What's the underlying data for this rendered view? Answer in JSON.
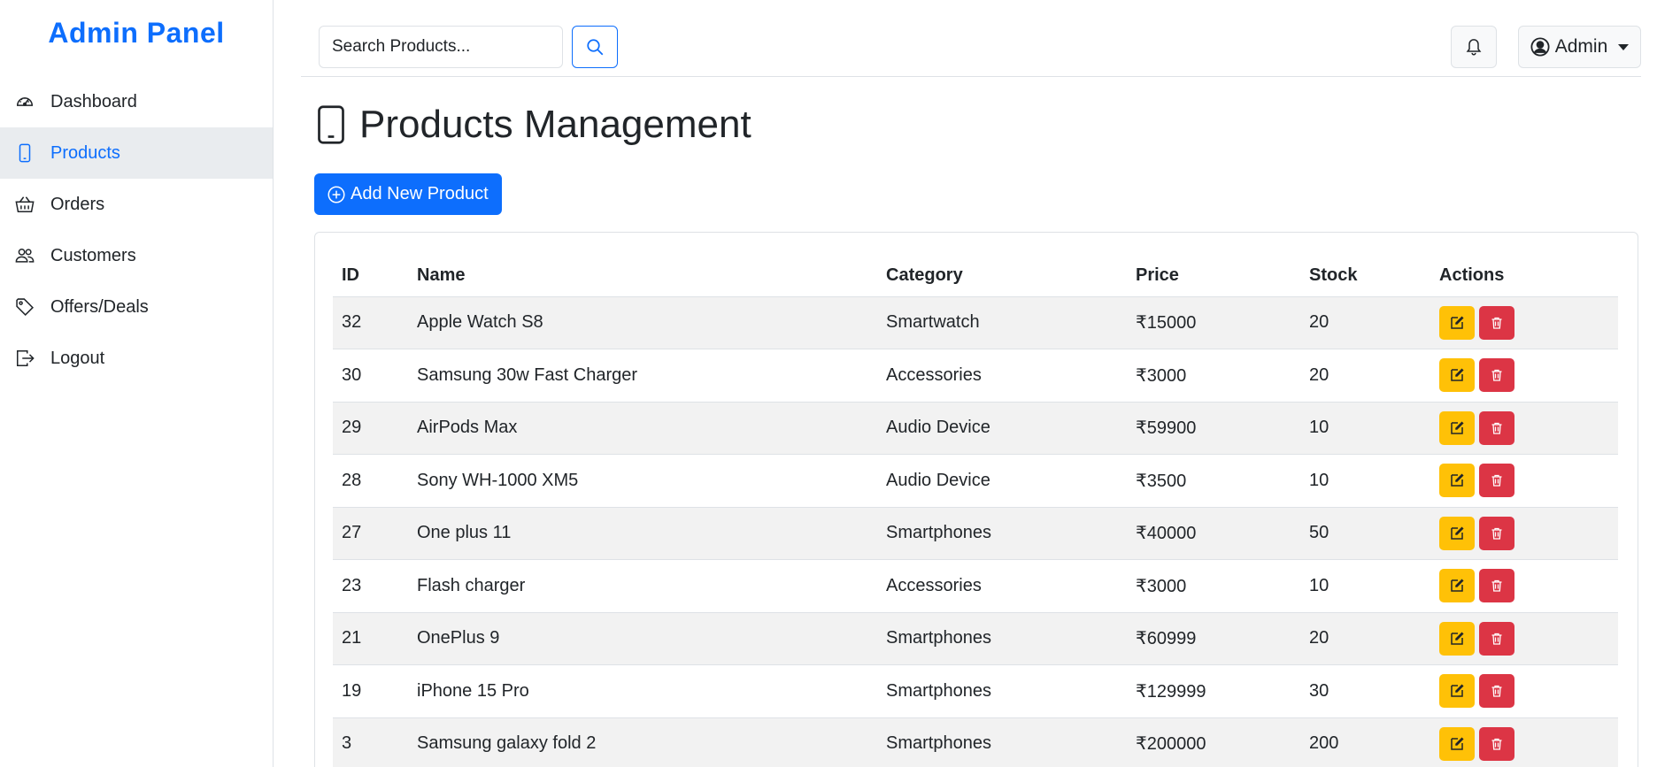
{
  "sidebar": {
    "brand": "Admin Panel",
    "items": [
      {
        "label": "Dashboard",
        "icon": "speedometer-icon"
      },
      {
        "label": "Products",
        "icon": "phone-icon",
        "active": true
      },
      {
        "label": "Orders",
        "icon": "basket-icon"
      },
      {
        "label": "Customers",
        "icon": "people-icon"
      },
      {
        "label": "Offers/Deals",
        "icon": "tag-icon"
      },
      {
        "label": "Logout",
        "icon": "logout-icon"
      }
    ]
  },
  "topbar": {
    "search_placeholder": "Search Products...",
    "user_label": "Admin"
  },
  "main": {
    "title": "Products Management",
    "add_button_label": "Add New Product"
  },
  "table": {
    "headers": [
      "ID",
      "Name",
      "Category",
      "Price",
      "Stock",
      "Actions"
    ],
    "rows": [
      {
        "id": "32",
        "name": "Apple Watch S8",
        "category": "Smartwatch",
        "price": "₹15000",
        "stock": "20"
      },
      {
        "id": "30",
        "name": "Samsung 30w Fast Charger",
        "category": "Accessories",
        "price": "₹3000",
        "stock": "20"
      },
      {
        "id": "29",
        "name": "AirPods Max",
        "category": "Audio Device",
        "price": "₹59900",
        "stock": "10"
      },
      {
        "id": "28",
        "name": "Sony WH-1000 XM5",
        "category": "Audio Device",
        "price": "₹3500",
        "stock": "10"
      },
      {
        "id": "27",
        "name": "One plus 11",
        "category": "Smartphones",
        "price": "₹40000",
        "stock": "50"
      },
      {
        "id": "23",
        "name": "Flash charger",
        "category": "Accessories",
        "price": "₹3000",
        "stock": "10"
      },
      {
        "id": "21",
        "name": "OnePlus 9",
        "category": "Smartphones",
        "price": "₹60999",
        "stock": "20"
      },
      {
        "id": "19",
        "name": "iPhone 15 Pro",
        "category": "Smartphones",
        "price": "₹129999",
        "stock": "30"
      },
      {
        "id": "3",
        "name": "Samsung galaxy fold 2",
        "category": "Smartphones",
        "price": "₹200000",
        "stock": "200"
      }
    ]
  },
  "colors": {
    "primary": "#0d6efd",
    "warning": "#ffc107",
    "danger": "#dc3545",
    "active_bg": "#e9ecef",
    "striped_row": "#f2f2f2"
  }
}
